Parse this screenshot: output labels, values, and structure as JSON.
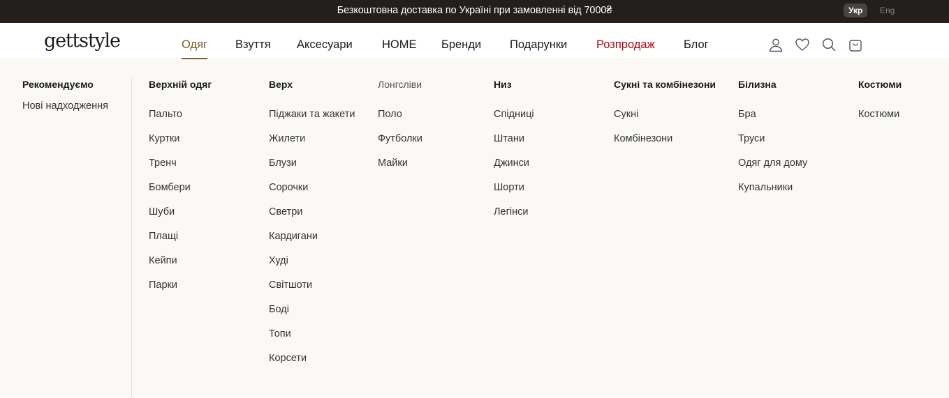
{
  "topbar": {
    "promo": "Безкоштовна доставка по Україні при замовленні від 7000₴",
    "lang_active": "Укр",
    "lang_inactive": "Eng"
  },
  "header": {
    "logo": "gettstyle",
    "nav": [
      {
        "label": "Одяг"
      },
      {
        "label": "Взуття"
      },
      {
        "label": "Аксесуари"
      },
      {
        "label": "HOME"
      },
      {
        "label": "Бренди"
      },
      {
        "label": "Подарунки"
      },
      {
        "label": "Розпродаж"
      },
      {
        "label": "Блог"
      }
    ],
    "icons": [
      "user-icon",
      "heart-icon",
      "search-icon",
      "bag-icon"
    ]
  },
  "colors": {
    "accent": "#7a5c2e",
    "sale": "#b3000e",
    "topbar_bg": "#231f1c",
    "menu_bg": "#faf9f5"
  },
  "menu": {
    "recommend": {
      "title": "Рекомендуємо",
      "items": [
        "Нові надходження"
      ]
    },
    "columns": [
      {
        "title": "Верхній одяг",
        "items": [
          "Пальто",
          "Куртки",
          "Тренч",
          "Бомбери",
          "Шуби",
          "Плащі",
          "Кейпи",
          "Парки"
        ]
      },
      {
        "title": "Верх",
        "items": [
          "Піджаки та жакети",
          "Жилети",
          "Блузи",
          "Сорочки",
          "Светри",
          "Кардигани",
          "Худі",
          "Світшоти",
          "Боді",
          "Топи",
          "Корсети"
        ]
      },
      {
        "title": "Лонгсліви",
        "items": [
          "Поло",
          "Футболки",
          "Майки"
        ]
      },
      {
        "title": "Низ",
        "items": [
          "Спідниці",
          "Штани",
          "Джинси",
          "Шорти",
          "Легінси"
        ]
      },
      {
        "title": "Сукні та комбінезони",
        "items": [
          "Сукні",
          "Комбінезони"
        ]
      },
      {
        "title": "Білизна",
        "items": [
          "Бра",
          "Труси",
          "Одяг для дому",
          "Купальники"
        ]
      },
      {
        "title": "Костюми",
        "items": [
          "Костюми"
        ]
      }
    ]
  }
}
